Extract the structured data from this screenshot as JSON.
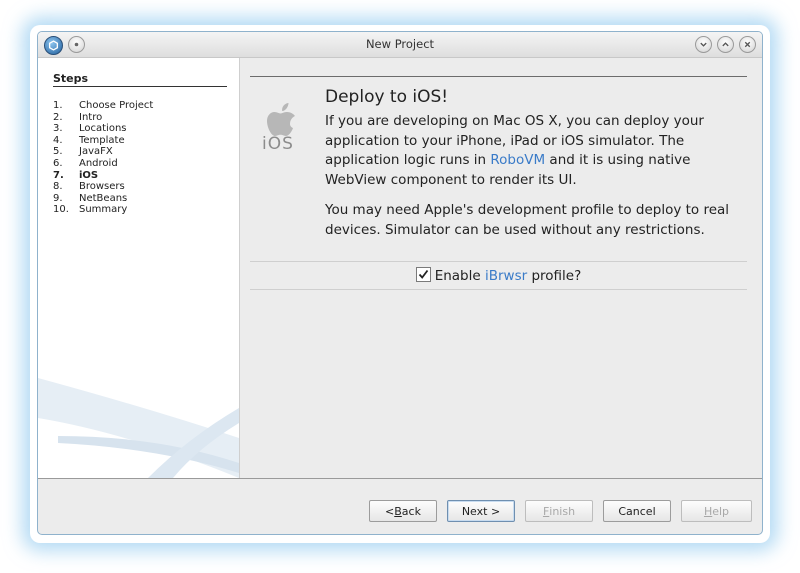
{
  "window": {
    "title": "New Project"
  },
  "steps": {
    "title": "Steps",
    "items": [
      {
        "num": "1.",
        "label": "Choose Project"
      },
      {
        "num": "2.",
        "label": "Intro"
      },
      {
        "num": "3.",
        "label": "Locations"
      },
      {
        "num": "4.",
        "label": "Template"
      },
      {
        "num": "5.",
        "label": "JavaFX"
      },
      {
        "num": "6.",
        "label": "Android"
      },
      {
        "num": "7.",
        "label": "iOS",
        "current": true
      },
      {
        "num": "8.",
        "label": "Browsers"
      },
      {
        "num": "9.",
        "label": "NetBeans"
      },
      {
        "num": "10.",
        "label": "Summary"
      }
    ]
  },
  "content": {
    "logo_text": "iOS",
    "heading": "Deploy to iOS!",
    "p1_before": "If you are developing on Mac OS X, you can deploy your application to your iPhone, iPad or iOS simulator. The application logic runs in ",
    "p1_link": "RoboVM",
    "p1_after": " and it is using native WebView component to render its UI.",
    "p2": "You may need Apple's development profile to deploy to real devices. Simulator can be used without any restrictions.",
    "profile": {
      "checked": true,
      "label_before": "Enable ",
      "label_link": "iBrwsr",
      "label_after": " profile?"
    }
  },
  "buttons": {
    "back": {
      "prefix": "< ",
      "mnemonic": "B",
      "rest": "ack"
    },
    "next": "Next >",
    "finish": {
      "mnemonic": "F",
      "rest": "inish"
    },
    "cancel": "Cancel",
    "help": {
      "mnemonic": "H",
      "rest": "elp"
    }
  },
  "colors": {
    "link": "#3a7bc8",
    "glow": "#78bee8"
  }
}
